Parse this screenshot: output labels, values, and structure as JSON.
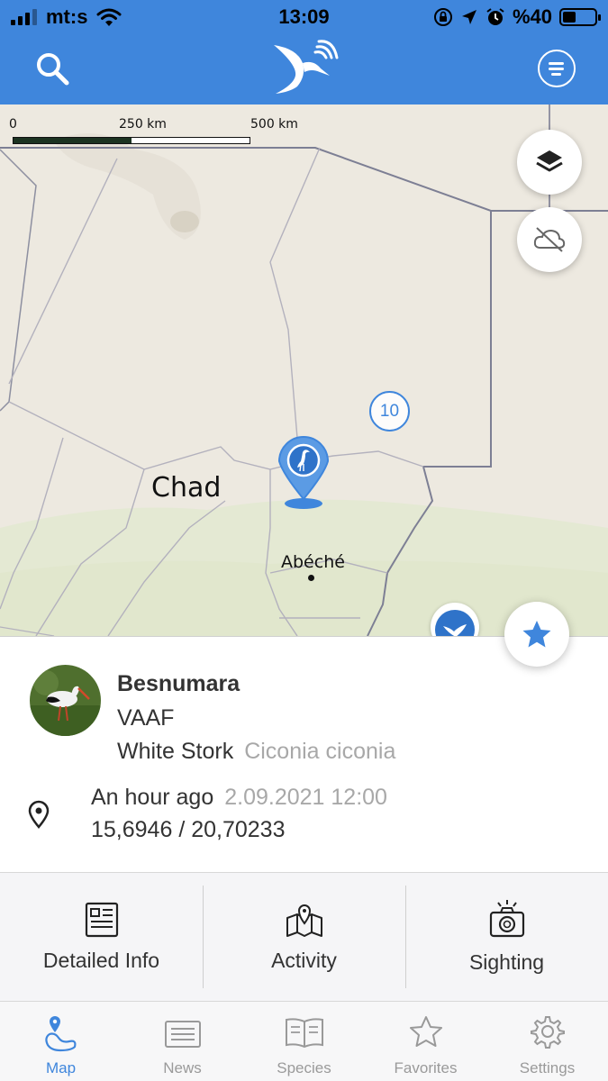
{
  "status_bar": {
    "carrier": "mt:s",
    "time": "13:09",
    "battery": "%40",
    "battery_level": 0.4,
    "icons": [
      "signal-icon",
      "wifi-icon",
      "orientation-lock-icon",
      "location-arrow-icon",
      "alarm-icon",
      "battery-icon"
    ]
  },
  "header": {
    "icons": [
      "search-icon",
      "stork-logo",
      "menu-icon"
    ],
    "brand_color": "#3f86dc"
  },
  "map": {
    "scale": {
      "labels": [
        "0",
        "250 km",
        "500 km"
      ]
    },
    "country_label": "Chad",
    "city_label": "Abéché",
    "cluster_count": "10",
    "buttons": [
      "layers-icon",
      "cloud-off-icon"
    ]
  },
  "animal": {
    "name": "Besnumara",
    "code": "VAAF",
    "species": "White Stork",
    "scientific_name": "Ciconia ciconia",
    "last_seen": "An hour ago",
    "timestamp": "2.09.2021 12:00",
    "coordinates": "15,6946 / 20,70233"
  },
  "actions": [
    {
      "label": "Detailed Info",
      "icon": "document-icon"
    },
    {
      "label": "Activity",
      "icon": "map-pin-icon"
    },
    {
      "label": "Sighting",
      "icon": "camera-icon"
    }
  ],
  "tabs": [
    {
      "label": "Map",
      "icon": "map-icon",
      "active": true
    },
    {
      "label": "News",
      "icon": "news-icon",
      "active": false
    },
    {
      "label": "Species",
      "icon": "book-icon",
      "active": false
    },
    {
      "label": "Favorites",
      "icon": "star-icon",
      "active": false
    },
    {
      "label": "Settings",
      "icon": "gear-icon",
      "active": false
    }
  ],
  "colors": {
    "accent": "#3f86dc",
    "muted_text": "#a8a8a8",
    "map_land": "#ede9e0",
    "map_green": "#e4e9d3"
  }
}
